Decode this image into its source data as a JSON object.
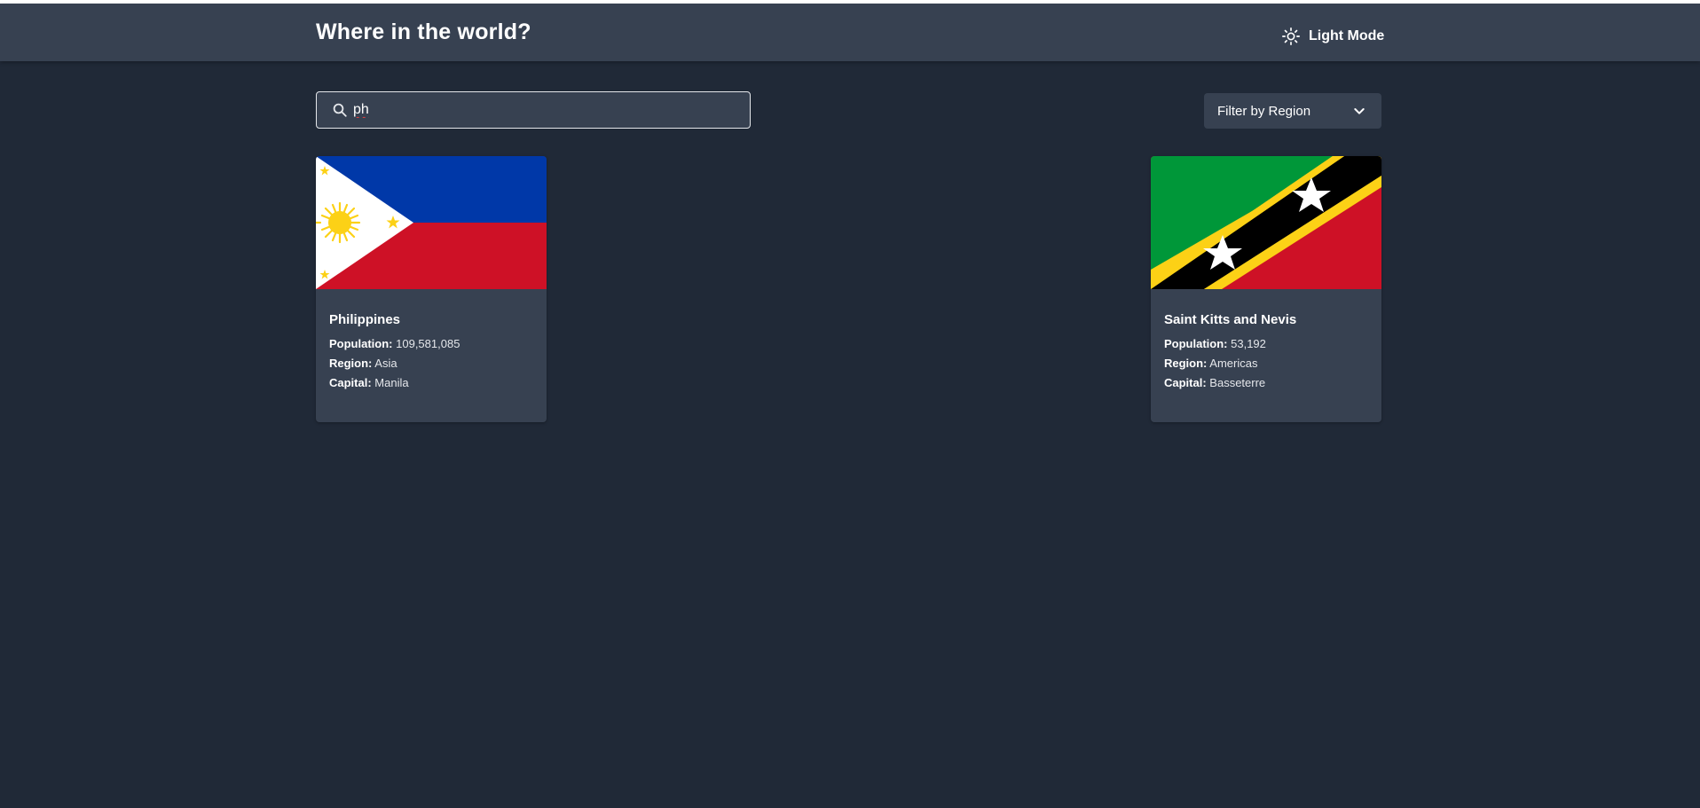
{
  "header": {
    "title": "Where in the world?",
    "mode_label": "Light Mode",
    "mode_icon": "sun-icon"
  },
  "search": {
    "value": "ph",
    "icon": "search-icon"
  },
  "filter": {
    "label": "Filter by Region",
    "icon": "chevron-down-icon"
  },
  "countries": [
    {
      "name": "Philippines",
      "population_label": "Population:",
      "population": "109,581,085",
      "region_label": "Region:",
      "region": "Asia",
      "capital_label": "Capital:",
      "capital": "Manila",
      "flag": "philippines-flag"
    },
    {
      "name": "Saint Kitts and Nevis",
      "population_label": "Population:",
      "population": "53,192",
      "region_label": "Region:",
      "region": "Americas",
      "capital_label": "Capital:",
      "capital": "Basseterre",
      "flag": "saint-kitts-and-nevis-flag"
    }
  ],
  "colors": {
    "background": "#202937",
    "surface": "#374151",
    "text": "#ffffff"
  }
}
